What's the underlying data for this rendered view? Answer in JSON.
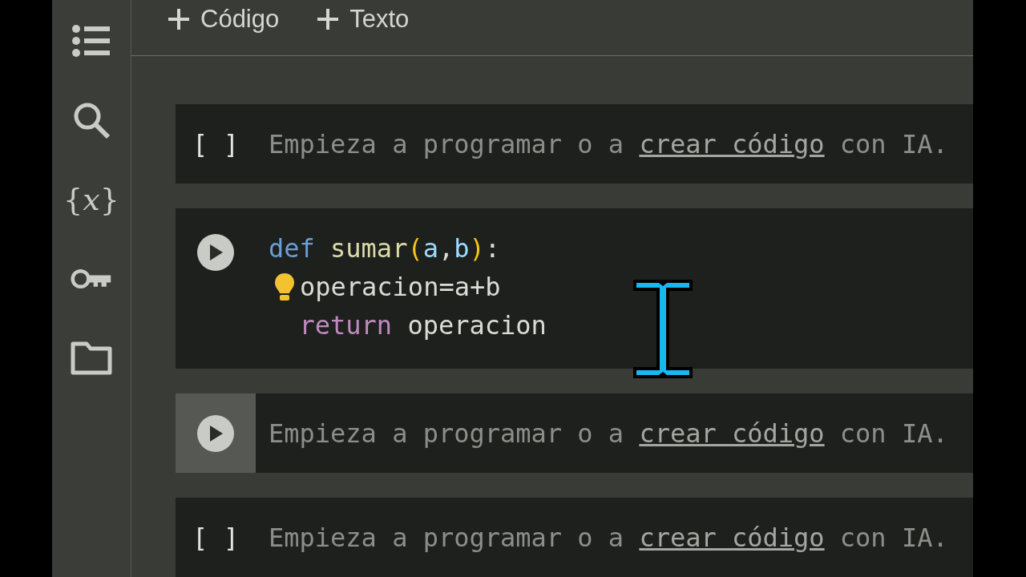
{
  "sidebar": {
    "items": [
      {
        "kind": "list"
      },
      {
        "kind": "search"
      },
      {
        "kind": "glyph",
        "glyph": "{*x*}"
      },
      {
        "kind": "key"
      },
      {
        "kind": "folder"
      }
    ]
  },
  "toolbar": {
    "buttons": [
      {
        "label": "Código"
      },
      {
        "label": "Texto"
      }
    ]
  },
  "cells": [
    {
      "kind": "empty",
      "bracket": "[ ]",
      "hovered": false,
      "placeholder": {
        "before": "Empieza a programar o a",
        "link": "crear código",
        "after": "con IA."
      }
    },
    {
      "kind": "code",
      "hovered": false,
      "lines": [
        {
          "lightbulb": false,
          "tokens": [
            {
              "kind": "keyword",
              "text": "def "
            },
            {
              "kind": "function",
              "text": "sumar"
            },
            {
              "kind": "paren",
              "text": "("
            },
            {
              "kind": "param",
              "text": "a"
            },
            {
              "kind": "plain",
              "text": ","
            },
            {
              "kind": "param",
              "text": "b"
            },
            {
              "kind": "paren",
              "text": ")"
            },
            {
              "kind": "plain",
              "text": ":"
            }
          ]
        },
        {
          "lightbulb": true,
          "tokens": [
            {
              "kind": "plain",
              "text": "operacion=a+b"
            }
          ]
        },
        {
          "lightbulb": false,
          "tokens": [
            {
              "kind": "control",
              "text": "  return"
            },
            {
              "kind": "plain",
              "text": " operacion"
            }
          ]
        }
      ]
    },
    {
      "kind": "empty_run",
      "hovered": true,
      "placeholder": {
        "before": "Empieza a programar o a",
        "link": "crear código",
        "after": "con IA."
      }
    },
    {
      "kind": "empty",
      "bracket": "[ ]",
      "hovered": false,
      "placeholder": {
        "before": "Empieza a programar o a",
        "link": "crear código",
        "after": "con IA."
      }
    }
  ]
}
